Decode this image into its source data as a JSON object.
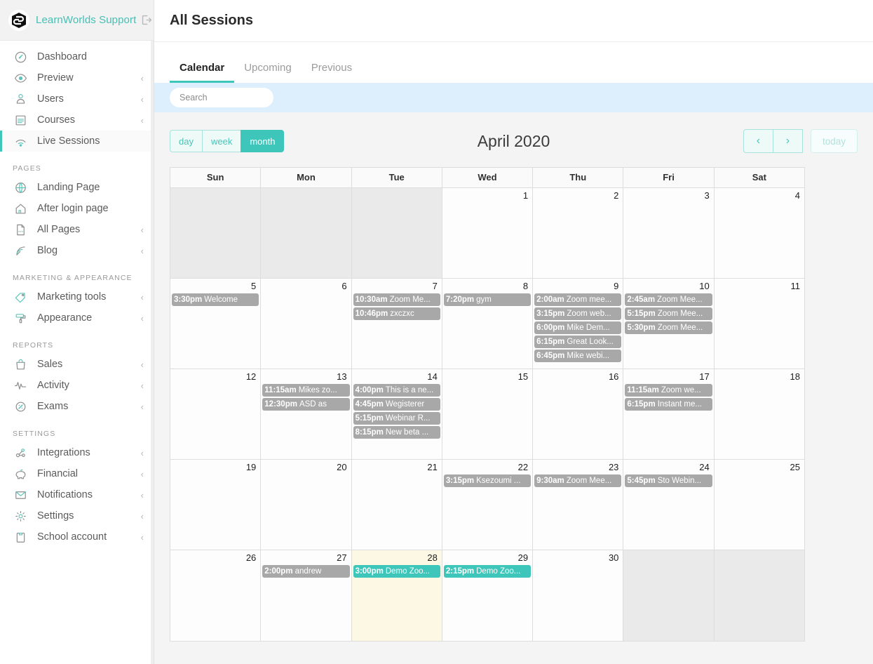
{
  "sidebar": {
    "brand": {
      "name": "LearnWorlds Support",
      "logo_icon": "learnworlds-logo-icon",
      "exit_icon": "exit-icon"
    },
    "groups": [
      {
        "title": "",
        "items": [
          {
            "label": "Dashboard",
            "icon": "dashboard-icon",
            "chevron": "",
            "active": false
          },
          {
            "label": "Preview",
            "icon": "eye-icon",
            "chevron": "‹",
            "active": false
          },
          {
            "label": "Users",
            "icon": "user-icon",
            "chevron": "‹",
            "active": false
          },
          {
            "label": "Courses",
            "icon": "courses-icon",
            "chevron": "‹",
            "active": false
          },
          {
            "label": "Live Sessions",
            "icon": "live-sessions-icon",
            "chevron": "",
            "active": true
          }
        ]
      },
      {
        "title": "PAGES",
        "items": [
          {
            "label": "Landing Page",
            "icon": "globe-icon",
            "chevron": "",
            "active": false
          },
          {
            "label": "After login page",
            "icon": "home-icon",
            "chevron": "",
            "active": false
          },
          {
            "label": "All Pages",
            "icon": "page-icon",
            "chevron": "‹",
            "active": false
          },
          {
            "label": "Blog",
            "icon": "rss-icon",
            "chevron": "‹",
            "active": false
          }
        ]
      },
      {
        "title": "MARKETING & APPEARANCE",
        "items": [
          {
            "label": "Marketing tools",
            "icon": "tag-icon",
            "chevron": "‹",
            "active": false
          },
          {
            "label": "Appearance",
            "icon": "paint-roller-icon",
            "chevron": "‹",
            "active": false
          }
        ]
      },
      {
        "title": "REPORTS",
        "items": [
          {
            "label": "Sales",
            "icon": "shopping-bag-icon",
            "chevron": "‹",
            "active": false
          },
          {
            "label": "Activity",
            "icon": "pulse-icon",
            "chevron": "‹",
            "active": false
          },
          {
            "label": "Exams",
            "icon": "percent-badge-icon",
            "chevron": "‹",
            "active": false
          }
        ]
      },
      {
        "title": "SETTINGS",
        "items": [
          {
            "label": "Integrations",
            "icon": "integrations-icon",
            "chevron": "‹",
            "active": false
          },
          {
            "label": "Financial",
            "icon": "piggy-bank-icon",
            "chevron": "‹",
            "active": false
          },
          {
            "label": "Notifications",
            "icon": "envelope-icon",
            "chevron": "‹",
            "active": false
          },
          {
            "label": "Settings",
            "icon": "gear-icon",
            "chevron": "‹",
            "active": false
          },
          {
            "label": "School account",
            "icon": "clipboard-icon",
            "chevron": "‹",
            "active": false
          }
        ]
      }
    ]
  },
  "header": {
    "title": "All Sessions"
  },
  "tabs": [
    {
      "label": "Calendar",
      "active": true
    },
    {
      "label": "Upcoming",
      "active": false
    },
    {
      "label": "Previous",
      "active": false
    }
  ],
  "search": {
    "value": "",
    "placeholder": "Search"
  },
  "calendar": {
    "title": "April 2020",
    "views": [
      {
        "label": "day",
        "active": false
      },
      {
        "label": "week",
        "active": false
      },
      {
        "label": "month",
        "active": true
      }
    ],
    "prev_label": "‹",
    "next_label": "›",
    "today_label": "today",
    "dow": [
      "Sun",
      "Mon",
      "Tue",
      "Wed",
      "Thu",
      "Fri",
      "Sat"
    ],
    "weeks": [
      [
        {
          "num": "",
          "other": true,
          "today": false,
          "events": []
        },
        {
          "num": "",
          "other": true,
          "today": false,
          "events": []
        },
        {
          "num": "",
          "other": true,
          "today": false,
          "events": []
        },
        {
          "num": "1",
          "other": false,
          "today": false,
          "events": []
        },
        {
          "num": "2",
          "other": false,
          "today": false,
          "events": []
        },
        {
          "num": "3",
          "other": false,
          "today": false,
          "events": []
        },
        {
          "num": "4",
          "other": false,
          "today": false,
          "events": []
        }
      ],
      [
        {
          "num": "5",
          "other": false,
          "today": false,
          "events": [
            {
              "time": "3:30pm",
              "name": "Welcome",
              "teal": false
            }
          ]
        },
        {
          "num": "6",
          "other": false,
          "today": false,
          "events": []
        },
        {
          "num": "7",
          "other": false,
          "today": false,
          "events": [
            {
              "time": "10:30am",
              "name": "Zoom Me...",
              "teal": false
            },
            {
              "time": "10:46pm",
              "name": "zxczxc",
              "teal": false
            }
          ]
        },
        {
          "num": "8",
          "other": false,
          "today": false,
          "events": [
            {
              "time": "7:20pm",
              "name": "gym",
              "teal": false
            }
          ]
        },
        {
          "num": "9",
          "other": false,
          "today": false,
          "events": [
            {
              "time": "2:00am",
              "name": "Zoom mee...",
              "teal": false
            },
            {
              "time": "3:15pm",
              "name": "Zoom web...",
              "teal": false
            },
            {
              "time": "6:00pm",
              "name": "Mike Dem...",
              "teal": false
            },
            {
              "time": "6:15pm",
              "name": "Great Look...",
              "teal": false
            },
            {
              "time": "6:45pm",
              "name": "Mike webi...",
              "teal": false
            }
          ]
        },
        {
          "num": "10",
          "other": false,
          "today": false,
          "events": [
            {
              "time": "2:45am",
              "name": "Zoom Mee...",
              "teal": false
            },
            {
              "time": "5:15pm",
              "name": "Zoom Mee...",
              "teal": false
            },
            {
              "time": "5:30pm",
              "name": "Zoom Mee...",
              "teal": false
            }
          ]
        },
        {
          "num": "11",
          "other": false,
          "today": false,
          "events": []
        }
      ],
      [
        {
          "num": "12",
          "other": false,
          "today": false,
          "events": []
        },
        {
          "num": "13",
          "other": false,
          "today": false,
          "events": [
            {
              "time": "11:15am",
              "name": "Mikes zo...",
              "teal": false
            },
            {
              "time": "12:30pm",
              "name": "ASD as",
              "teal": false
            }
          ]
        },
        {
          "num": "14",
          "other": false,
          "today": false,
          "events": [
            {
              "time": "4:00pm",
              "name": "This is a ne...",
              "teal": false
            },
            {
              "time": "4:45pm",
              "name": "Wegisterer",
              "teal": false
            },
            {
              "time": "5:15pm",
              "name": "Webinar R...",
              "teal": false
            },
            {
              "time": "8:15pm",
              "name": "New beta ...",
              "teal": false
            }
          ]
        },
        {
          "num": "15",
          "other": false,
          "today": false,
          "events": []
        },
        {
          "num": "16",
          "other": false,
          "today": false,
          "events": []
        },
        {
          "num": "17",
          "other": false,
          "today": false,
          "events": [
            {
              "time": "11:15am",
              "name": "Zoom we...",
              "teal": false
            },
            {
              "time": "6:15pm",
              "name": "Instant me...",
              "teal": false
            }
          ]
        },
        {
          "num": "18",
          "other": false,
          "today": false,
          "events": []
        }
      ],
      [
        {
          "num": "19",
          "other": false,
          "today": false,
          "events": []
        },
        {
          "num": "20",
          "other": false,
          "today": false,
          "events": []
        },
        {
          "num": "21",
          "other": false,
          "today": false,
          "events": []
        },
        {
          "num": "22",
          "other": false,
          "today": false,
          "events": [
            {
              "time": "3:15pm",
              "name": "Ksezoumi ...",
              "teal": false
            }
          ]
        },
        {
          "num": "23",
          "other": false,
          "today": false,
          "events": [
            {
              "time": "9:30am",
              "name": "Zoom Mee...",
              "teal": false
            }
          ]
        },
        {
          "num": "24",
          "other": false,
          "today": false,
          "events": [
            {
              "time": "5:45pm",
              "name": "Sto Webin...",
              "teal": false
            }
          ]
        },
        {
          "num": "25",
          "other": false,
          "today": false,
          "events": []
        }
      ],
      [
        {
          "num": "26",
          "other": false,
          "today": false,
          "events": []
        },
        {
          "num": "27",
          "other": false,
          "today": false,
          "events": [
            {
              "time": "2:00pm",
              "name": "andrew",
              "teal": false
            }
          ]
        },
        {
          "num": "28",
          "other": false,
          "today": true,
          "events": [
            {
              "time": "3:00pm",
              "name": "Demo Zoo...",
              "teal": true
            }
          ]
        },
        {
          "num": "29",
          "other": false,
          "today": false,
          "events": [
            {
              "time": "2:15pm",
              "name": "Demo Zoo...",
              "teal": true
            }
          ]
        },
        {
          "num": "30",
          "other": false,
          "today": false,
          "events": []
        },
        {
          "num": "",
          "other": true,
          "today": false,
          "events": []
        },
        {
          "num": "",
          "other": true,
          "today": false,
          "events": []
        }
      ]
    ]
  },
  "colors": {
    "accent": "#3dc6b9",
    "event_default": "#a8a8a8",
    "today_bg": "#fcf8e3",
    "search_band": "#ddeefc",
    "other_month_bg": "#eaeaea"
  }
}
